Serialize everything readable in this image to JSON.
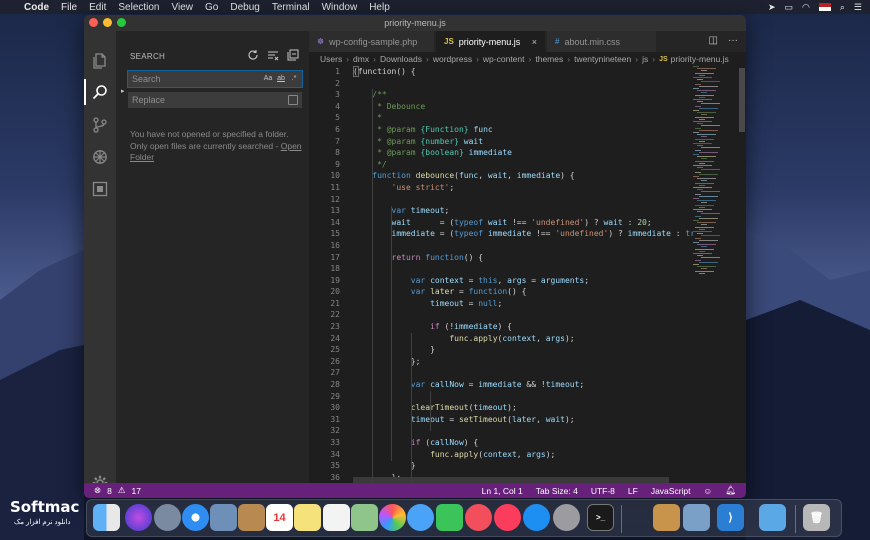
{
  "menubar": {
    "app_name": "Code",
    "items": [
      "File",
      "Edit",
      "Selection",
      "View",
      "Go",
      "Debug",
      "Terminal",
      "Window",
      "Help"
    ]
  },
  "window": {
    "title": "priority-menu.js"
  },
  "sidebar": {
    "title": "SEARCH",
    "search_placeholder": "Search",
    "search_opts": [
      "Aa",
      "ab",
      ".*"
    ],
    "replace_placeholder": "Replace",
    "message": "You have not opened or specified a folder. Only open files are currently searched -",
    "open_folder_link": "Open Folder"
  },
  "tabs": [
    {
      "label": "wp-config-sample.php",
      "icon": "php-file-icon",
      "active": false
    },
    {
      "label": "priority-menu.js",
      "icon": "js-file-icon",
      "active": true
    },
    {
      "label": "about.min.css",
      "icon": "css-file-icon",
      "active": false
    }
  ],
  "breadcrumb": [
    "Users",
    "dmx",
    "Downloads",
    "wordpress",
    "wp-content",
    "themes",
    "twentynineteen",
    "js",
    "priority-menu.js"
  ],
  "editor": {
    "line_numbers": [
      "1",
      "2",
      "3",
      "4",
      "5",
      "6",
      "7",
      "8",
      "9",
      "10",
      "11",
      "12",
      "13",
      "14",
      "15",
      "16",
      "17",
      "18",
      "19",
      "20",
      "21",
      "22",
      "23",
      "24",
      "25",
      "26",
      "27",
      "28",
      "29",
      "30",
      "31",
      "32",
      "33",
      "34",
      "35",
      "36"
    ],
    "lines": [
      [
        [
          "p",
          "(function() {"
        ]
      ],
      [],
      [
        [
          "cm",
          "    /**"
        ]
      ],
      [
        [
          "cm",
          "     * Debounce"
        ]
      ],
      [
        [
          "cm",
          "     *"
        ]
      ],
      [
        [
          "cm",
          "     * @param "
        ],
        [
          "ty",
          "{Function}"
        ],
        [
          "cm",
          " "
        ],
        [
          "var",
          "func"
        ]
      ],
      [
        [
          "cm",
          "     * @param "
        ],
        [
          "ty",
          "{number}"
        ],
        [
          "cm",
          " "
        ],
        [
          "var",
          "wait"
        ]
      ],
      [
        [
          "cm",
          "     * @param "
        ],
        [
          "ty",
          "{boolean}"
        ],
        [
          "cm",
          " "
        ],
        [
          "var",
          "immediate"
        ]
      ],
      [
        [
          "cm",
          "     */"
        ]
      ],
      [
        [
          "kw",
          "    function "
        ],
        [
          "fn",
          "debounce"
        ],
        [
          "p",
          "("
        ],
        [
          "var",
          "func"
        ],
        [
          "p",
          ", "
        ],
        [
          "var",
          "wait"
        ],
        [
          "p",
          ", "
        ],
        [
          "var",
          "immediate"
        ],
        [
          "p",
          ") {"
        ]
      ],
      [
        [
          "str",
          "        'use strict'"
        ],
        [
          "p",
          ";"
        ]
      ],
      [],
      [
        [
          "kw",
          "        var "
        ],
        [
          "var",
          "timeout"
        ],
        [
          "p",
          ";"
        ]
      ],
      [
        [
          "var",
          "        wait"
        ],
        [
          "p",
          "      = ("
        ],
        [
          "kw",
          "typeof "
        ],
        [
          "var",
          "wait"
        ],
        [
          "p",
          " !== "
        ],
        [
          "str",
          "'undefined'"
        ],
        [
          "p",
          ") ? "
        ],
        [
          "var",
          "wait"
        ],
        [
          "p",
          " : "
        ],
        [
          "num",
          "20"
        ],
        [
          "p",
          ";"
        ]
      ],
      [
        [
          "var",
          "        immediate"
        ],
        [
          "p",
          " = ("
        ],
        [
          "kw",
          "typeof "
        ],
        [
          "var",
          "immediate"
        ],
        [
          "p",
          " !== "
        ],
        [
          "str",
          "'undefined'"
        ],
        [
          "p",
          ") ? "
        ],
        [
          "var",
          "immediate"
        ],
        [
          "p",
          " : "
        ],
        [
          "kw",
          "true"
        ],
        [
          "p",
          ";"
        ]
      ],
      [],
      [
        [
          "ctl",
          "        return "
        ],
        [
          "kw",
          "function"
        ],
        [
          "p",
          "() {"
        ]
      ],
      [],
      [
        [
          "kw",
          "            var "
        ],
        [
          "var",
          "context"
        ],
        [
          "p",
          " = "
        ],
        [
          "kw",
          "this"
        ],
        [
          "p",
          ", "
        ],
        [
          "var",
          "args"
        ],
        [
          "p",
          " = "
        ],
        [
          "var",
          "arguments"
        ],
        [
          "p",
          ";"
        ]
      ],
      [
        [
          "kw",
          "            var "
        ],
        [
          "fn",
          "later"
        ],
        [
          "p",
          " = "
        ],
        [
          "kw",
          "function"
        ],
        [
          "p",
          "() {"
        ]
      ],
      [
        [
          "var",
          "                timeout"
        ],
        [
          "p",
          " = "
        ],
        [
          "kw",
          "null"
        ],
        [
          "p",
          ";"
        ]
      ],
      [],
      [
        [
          "ctl",
          "                if "
        ],
        [
          "p",
          "(!"
        ],
        [
          "var",
          "immediate"
        ],
        [
          "p",
          ") {"
        ]
      ],
      [
        [
          "fn",
          "                    func"
        ],
        [
          "p",
          "."
        ],
        [
          "fn",
          "apply"
        ],
        [
          "p",
          "("
        ],
        [
          "var",
          "context"
        ],
        [
          "p",
          ", "
        ],
        [
          "var",
          "args"
        ],
        [
          "p",
          ");"
        ]
      ],
      [
        [
          "p",
          "                }"
        ]
      ],
      [
        [
          "p",
          "            };"
        ]
      ],
      [],
      [
        [
          "kw",
          "            var "
        ],
        [
          "var",
          "callNow"
        ],
        [
          "p",
          " = "
        ],
        [
          "var",
          "immediate"
        ],
        [
          "p",
          " && !"
        ],
        [
          "var",
          "timeout"
        ],
        [
          "p",
          ";"
        ]
      ],
      [],
      [
        [
          "fn",
          "            clearTimeout"
        ],
        [
          "p",
          "("
        ],
        [
          "var",
          "timeout"
        ],
        [
          "p",
          ");"
        ]
      ],
      [
        [
          "var",
          "            timeout"
        ],
        [
          "p",
          " = "
        ],
        [
          "fn",
          "setTimeout"
        ],
        [
          "p",
          "("
        ],
        [
          "var",
          "later"
        ],
        [
          "p",
          ", "
        ],
        [
          "var",
          "wait"
        ],
        [
          "p",
          ");"
        ]
      ],
      [],
      [
        [
          "ctl",
          "            if "
        ],
        [
          "p",
          "("
        ],
        [
          "var",
          "callNow"
        ],
        [
          "p",
          ") {"
        ]
      ],
      [
        [
          "fn",
          "                func"
        ],
        [
          "p",
          "."
        ],
        [
          "fn",
          "apply"
        ],
        [
          "p",
          "("
        ],
        [
          "var",
          "context"
        ],
        [
          "p",
          ", "
        ],
        [
          "var",
          "args"
        ],
        [
          "p",
          ");"
        ]
      ],
      [
        [
          "p",
          "            }"
        ]
      ],
      [
        [
          "p",
          "        };"
        ]
      ]
    ]
  },
  "statusbar": {
    "errors": "8",
    "warnings": "17",
    "position": "Ln 1, Col 1",
    "tab_size": "Tab Size: 4",
    "encoding": "UTF-8",
    "eol": "LF",
    "language": "JavaScript"
  },
  "dock": {
    "apps": [
      "finder-icon",
      "siri-icon",
      "launchpad-icon",
      "safari-icon",
      "mail-preview-icon",
      "notes-folder-icon",
      "calendar-icon",
      "notes-icon",
      "reminders-icon",
      "maps-icon",
      "photos-icon",
      "messages-icon",
      "facetime-icon",
      "news-icon",
      "music-icon",
      "app-store-icon",
      "system-preferences-icon",
      "terminal-icon",
      "stacks-icon",
      "preview-icon",
      "vscode-icon",
      "downloads-folder-icon",
      "trash-icon"
    ],
    "calendar_day": "14"
  },
  "watermark": {
    "brand": "Softmac",
    "sub": "دانلود نرم افزار مک"
  },
  "colors": {
    "statusbar": "#68217a",
    "editor_bg": "#1e1e1e",
    "sidebar_bg": "#252526",
    "activity_bg": "#333333"
  }
}
